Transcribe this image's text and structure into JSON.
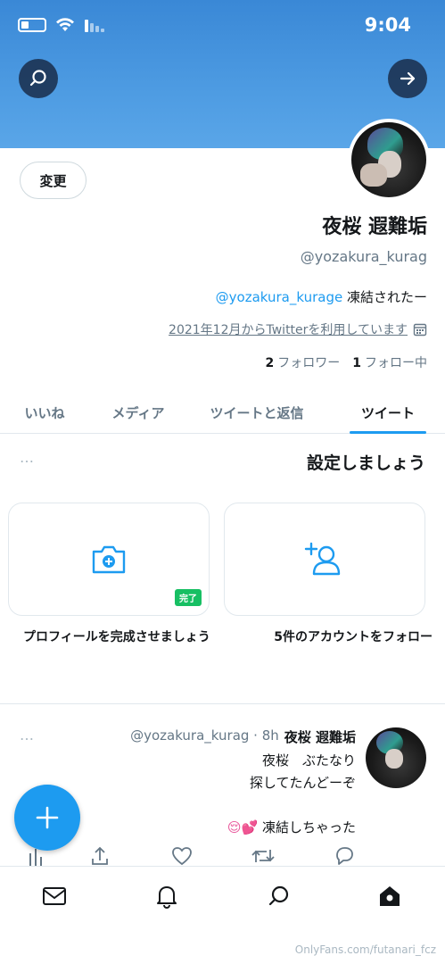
{
  "status": {
    "time": "9:04"
  },
  "profile": {
    "edit_label": "変更",
    "name": "夜桜 遐難垢",
    "handle": "@yozakura_kurag",
    "bio_prefix": "凍結されたー",
    "bio_mention": "@yozakura_kurage",
    "joined": "2021年12月からTwitterを利用しています",
    "following_count": "1",
    "following_label": "フォロー中",
    "followers_count": "2",
    "followers_label": "フォロワー"
  },
  "tabs": [
    {
      "label": "ツイート"
    },
    {
      "label": "ツイートと返信"
    },
    {
      "label": "メディア"
    },
    {
      "label": "いいね"
    }
  ],
  "setup": {
    "title": "設定しましょう",
    "more": "…",
    "cards": [
      {
        "label": "5件のアカウントをフォロー",
        "icon": "add-user-icon"
      },
      {
        "label": "プロフィールを完成させましょう",
        "icon": "camera-plus-icon",
        "badge": "完了"
      }
    ]
  },
  "tweet": {
    "name": "夜桜 遐難垢",
    "meta": "@yozakura_kurag · 8h",
    "lines": [
      "夜桜　ぶたなり",
      "探してたんどーぞ"
    ],
    "last_line": "凍結しちゃった",
    "emoji": "😌💕",
    "more": "…"
  },
  "nav": [
    {
      "icon": "home-icon"
    },
    {
      "icon": "search-icon"
    },
    {
      "icon": "bell-icon"
    },
    {
      "icon": "mail-icon"
    }
  ],
  "watermark": "OnlyFans.com/futanari_fcz",
  "colors": {
    "accent": "#1d9bf0",
    "header": "#4d9be2",
    "badge": "#17bf63"
  }
}
